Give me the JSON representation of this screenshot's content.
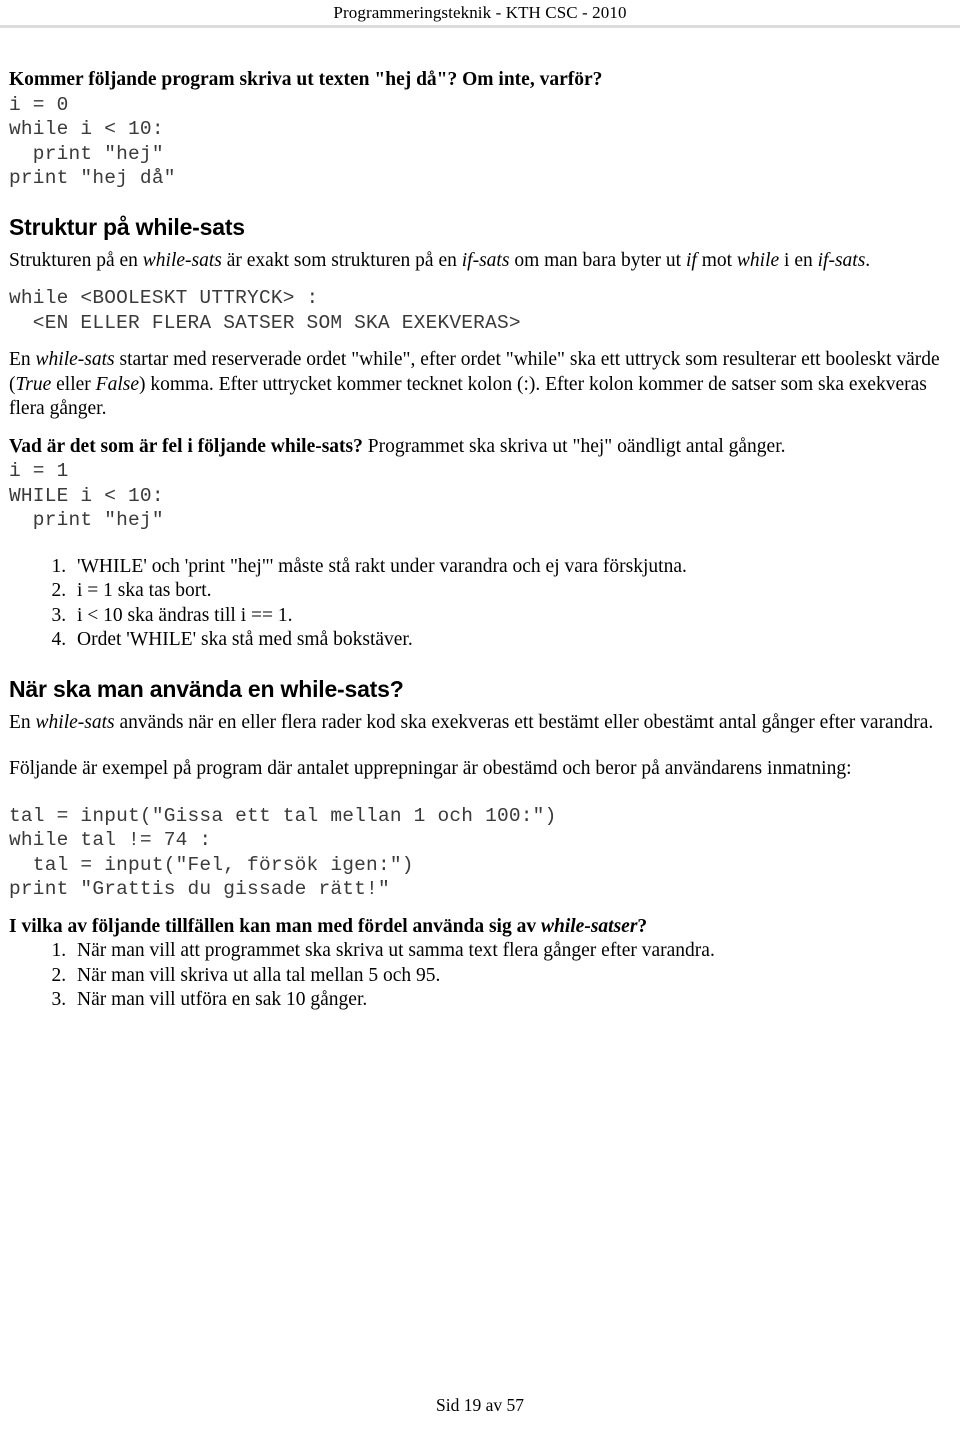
{
  "header": {
    "running_title": "Programmeringsteknik - KTH CSC - 2010"
  },
  "footer": {
    "page_label": "Sid 19 av 57"
  },
  "colors": {
    "text": "#000000",
    "code_text": "#3a3a3a",
    "rule": "#dcdcdc",
    "background": "#ffffff"
  },
  "blocks": {
    "q1_prompt": "Kommer följande program skriva ut texten \"hej då\"? Om inte, varför?",
    "q1_code": "i = 0\nwhile i < 10:\n  print \"hej\"\nprint \"hej då\"",
    "h_struktur": "Struktur på while-sats",
    "p_struktur_1": "Strukturen på en ",
    "p_struktur_i1": "while-sats",
    "p_struktur_2": " är exakt som strukturen på en ",
    "p_struktur_i2": "if-sats",
    "p_struktur_3": " om man bara byter ut ",
    "p_struktur_i3": "if",
    "p_struktur_4": " mot ",
    "p_struktur_i4": "while",
    "p_struktur_5": " i en ",
    "p_struktur_i5": "if-sats",
    "p_struktur_6": ".",
    "struktur_code": "while <BOOLESKT UTTRYCK> :\n  <EN ELLER FLERA SATSER SOM SKA EXEKVERAS>",
    "p_regler_1": "En ",
    "p_regler_i1": "while-sats",
    "p_regler_2": " startar med reserverade ordet \"while\", efter ordet \"while\" ska ett uttryck som resulterar ett booleskt värde (",
    "p_regler_i2": "True",
    "p_regler_3": " eller ",
    "p_regler_i3": "False",
    "p_regler_4": ") komma. Efter uttrycket kommer tecknet kolon (:). Efter kolon kommer de satser som ska exekveras flera gånger.",
    "q2_bold": "Vad är det som är fel i följande while-sats?",
    "q2_rest": " Programmet ska skriva ut \"hej\" oändligt antal gånger.",
    "q2_code": "i = 1\nWHILE i < 10:\n  print \"hej\"",
    "q2_options": [
      "'WHILE' och 'print \"hej\"' måste stå rakt under varandra och ej vara förskjutna.",
      "i = 1 ska tas bort.",
      "i < 10 ska ändras till i == 1.",
      "Ordet 'WHILE' ska stå med små bokstäver."
    ],
    "h_nar": "När ska man använda en while-sats?",
    "p_nar_1": "En ",
    "p_nar_i1": "while-sats",
    "p_nar_2": " används när en eller flera rader kod ska exekveras ett bestämt eller obestämt antal gånger efter varandra.",
    "p_foljande": "Följande är exempel på program där antalet upprepningar är obestämd och beror på användarens inmatning:",
    "gissa_code": "tal = input(\"Gissa ett tal mellan 1 och 100:\")\nwhile tal != 74 :\n  tal = input(\"Fel, försök igen:\")\nprint \"Grattis du gissade rätt!\"",
    "q3_bold_1": "I vilka av följande tillfällen kan man med fördel använda sig av ",
    "q3_bold_i": "while-satser",
    "q3_bold_2": "?",
    "q3_options": [
      "När man vill att programmet ska skriva ut samma text flera gånger efter varandra.",
      "När man vill skriva ut alla tal mellan 5 och 95.",
      "När man vill utföra en sak 10 gånger."
    ]
  }
}
